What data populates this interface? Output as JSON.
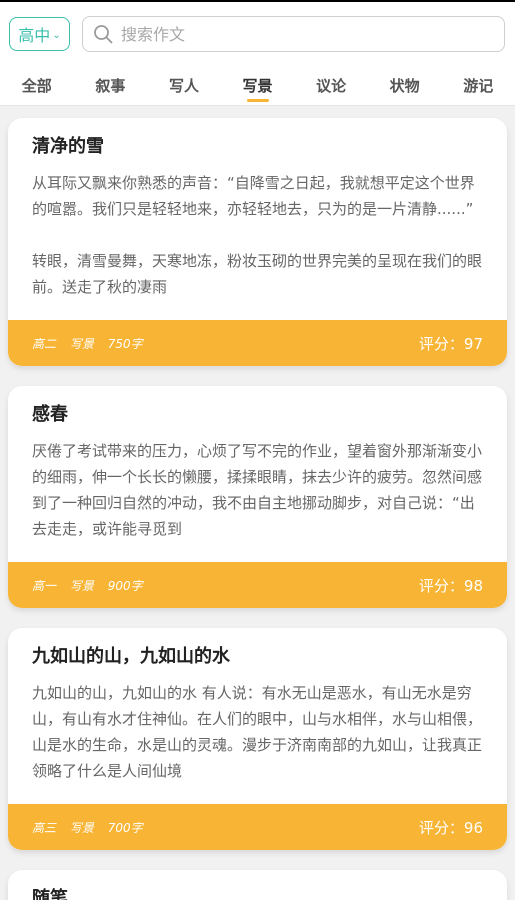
{
  "header": {
    "level_label": "高中",
    "search_placeholder": "搜索作文"
  },
  "tabs": [
    {
      "label": "全部"
    },
    {
      "label": "叙事"
    },
    {
      "label": "写人"
    },
    {
      "label": "写景",
      "active": true
    },
    {
      "label": "议论"
    },
    {
      "label": "状物"
    },
    {
      "label": "游记"
    }
  ],
  "colors": {
    "accent": "#3bbfad",
    "card_footer": "#f8b434"
  },
  "icons": {
    "search": "search-icon",
    "dropdown": "chevron-down-icon"
  },
  "articles": [
    {
      "title": "清净的雪",
      "excerpt": "从耳际又飘来你熟悉的声音：“自降雪之日起，我就想平定这个世界的喧嚣。我们只是轻轻地来，亦轻轻地去，只为的是一片清静......”\n\n转眼，清雪曼舞，天寒地冻，粉妆玉砌的世界完美的呈现在我们的眼前。送走了秋的凄雨",
      "grade": "高二",
      "genre": "写景",
      "words": "750字",
      "score": "评分：97"
    },
    {
      "title": "感春",
      "excerpt": "厌倦了考试带来的压力，心烦了写不完的作业，望着窗外那渐渐变小的细雨，伸一个长长的懒腰，揉揉眼睛，抹去少许的疲劳。忽然间感到了一种回归自然的冲动，我不由自主地挪动脚步，对自己说：“出去走走，或许能寻觅到",
      "grade": "高一",
      "genre": "写景",
      "words": "900字",
      "score": "评分：98"
    },
    {
      "title": "九如山的山，九如山的水",
      "excerpt": "九如山的山，九如山的水 有人说：有水无山是恶水，有山无水是穷山，有山有水才住神仙。在人们的眼中，山与水相伴，水与山相偎，山是水的生命，水是山的灵魂。漫步于济南南部的九如山，让我真正领略了什么是人间仙境",
      "grade": "高三",
      "genre": "写景",
      "words": "700字",
      "score": "评分：96"
    },
    {
      "title": "随笔"
    }
  ]
}
